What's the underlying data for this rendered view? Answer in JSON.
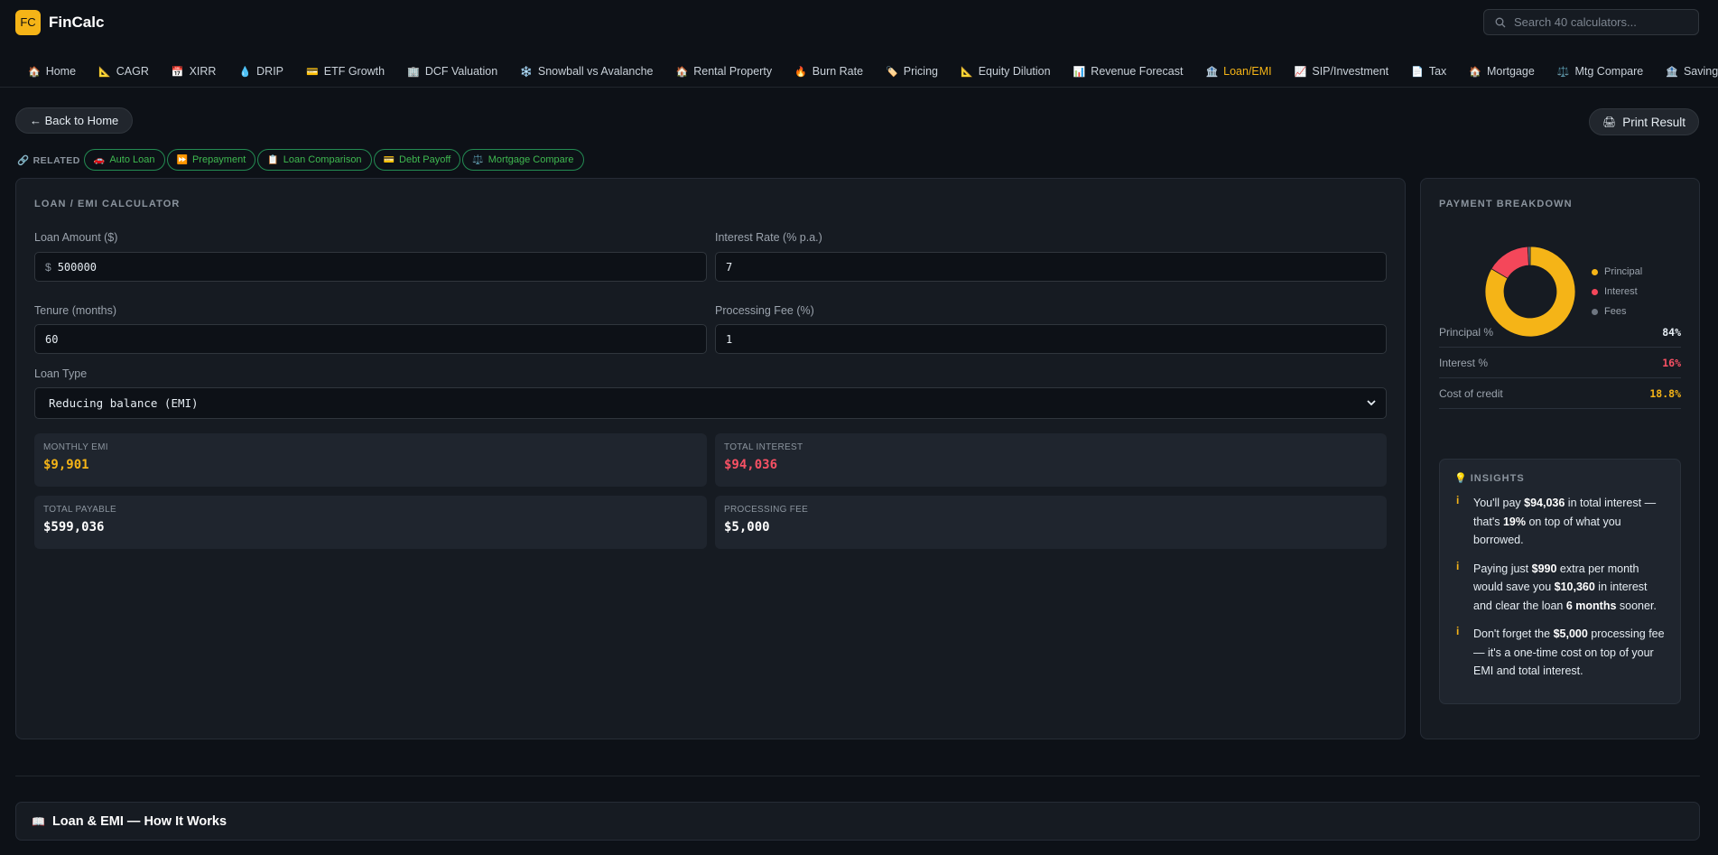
{
  "header": {
    "logo_text": "FC",
    "brand": "FinCalc",
    "search_placeholder": "Search 40 calculators..."
  },
  "nav": {
    "tabs": [
      {
        "icon": "🏠",
        "label": "Home"
      },
      {
        "icon": "📐",
        "label": "CAGR"
      },
      {
        "icon": "📅",
        "label": "XIRR"
      },
      {
        "icon": "💧",
        "label": "DRIP"
      },
      {
        "icon": "💳",
        "label": "ETF Growth"
      },
      {
        "icon": "🏢",
        "label": "DCF Valuation"
      },
      {
        "icon": "❄️",
        "label": "Snowball vs Avalanche"
      },
      {
        "icon": "🏠",
        "label": "Rental Property"
      },
      {
        "icon": "🔥",
        "label": "Burn Rate"
      },
      {
        "icon": "🏷️",
        "label": "Pricing"
      },
      {
        "icon": "📐",
        "label": "Equity Dilution"
      },
      {
        "icon": "📊",
        "label": "Revenue Forecast"
      },
      {
        "icon": "🏦",
        "label": "Loan/EMI"
      },
      {
        "icon": "📈",
        "label": "SIP/Investment"
      },
      {
        "icon": "📄",
        "label": "Tax"
      },
      {
        "icon": "🏠",
        "label": "Mortgage"
      },
      {
        "icon": "⚖️",
        "label": "Mtg Compare"
      },
      {
        "icon": "🏦",
        "label": "Savings"
      }
    ],
    "active_index": 12
  },
  "actions": {
    "back_label": "← Back to Home",
    "print_label": "Print Result"
  },
  "related": {
    "label": "RELATED",
    "chips": [
      {
        "icon": "🚗",
        "label": "Auto Loan"
      },
      {
        "icon": "⏩",
        "label": "Prepayment"
      },
      {
        "icon": "📋",
        "label": "Loan Comparison"
      },
      {
        "icon": "💳",
        "label": "Debt Payoff"
      },
      {
        "icon": "⚖️",
        "label": "Mortgage Compare"
      }
    ]
  },
  "calculator": {
    "title": "LOAN / EMI CALCULATOR",
    "loan_amount": {
      "label": "Loan Amount ($)",
      "prefix": "$",
      "value": "500000"
    },
    "interest_rate": {
      "label": "Interest Rate (% p.a.)",
      "value": "7"
    },
    "tenure": {
      "label": "Tenure (months)",
      "value": "60"
    },
    "processing_fee": {
      "label": "Processing Fee (%)",
      "value": "1"
    },
    "loan_type": {
      "label": "Loan Type",
      "value": "Reducing balance (EMI)"
    },
    "results": {
      "monthly_emi": {
        "label": "MONTHLY EMI",
        "value": "$9,901",
        "color": "#f5b417"
      },
      "total_interest": {
        "label": "TOTAL INTEREST",
        "value": "$94,036",
        "color": "#f85164"
      },
      "total_payable": {
        "label": "TOTAL PAYABLE",
        "value": "$599,036",
        "color": "#ffffff"
      },
      "processing_fee": {
        "label": "PROCESSING FEE",
        "value": "$5,000",
        "color": "#ffffff"
      }
    }
  },
  "breakdown": {
    "title": "PAYMENT BREAKDOWN",
    "legend": [
      {
        "label": "Principal",
        "color": "#f5b417"
      },
      {
        "label": "Interest",
        "color": "#f4475a"
      },
      {
        "label": "Fees",
        "color": "#6e7681"
      }
    ],
    "rows": [
      {
        "label": "Principal %",
        "value": "84%",
        "color": "#e6edf3"
      },
      {
        "label": "Interest %",
        "value": "16%",
        "color": "#f85164"
      },
      {
        "label": "Cost of credit",
        "value": "18.8%",
        "color": "#f5b417"
      }
    ]
  },
  "chart_data": {
    "type": "pie",
    "categories": [
      "Principal",
      "Interest",
      "Fees"
    ],
    "values": [
      500000,
      94036,
      5000
    ]
  },
  "insights": {
    "title": "INSIGHTS",
    "items": [
      {
        "parts": [
          "You'll pay ",
          "$94,036",
          " in total interest — that's ",
          "19%",
          " on top of what you borrowed."
        ]
      },
      {
        "parts": [
          "Paying just ",
          "$990",
          " extra per month would save you ",
          "$10,360",
          " in interest and clear the loan ",
          "6 months",
          " sooner."
        ]
      },
      {
        "parts": [
          "Don't forget the ",
          "$5,000",
          " processing fee — it's a one-time cost on top of your EMI and total interest."
        ]
      }
    ]
  },
  "how_it_works": {
    "icon": "📖",
    "label": "Loan & EMI — How It Works"
  }
}
